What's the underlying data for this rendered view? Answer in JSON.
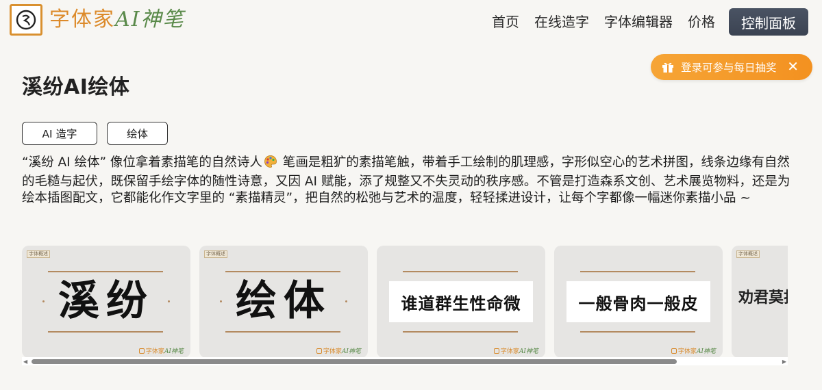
{
  "header": {
    "logo": {
      "brand_orange": "字体家",
      "brand_green": "AI神笔"
    },
    "nav": [
      "首页",
      "在线造字",
      "字体编辑器",
      "价格"
    ],
    "dashboard_label": "控制面板"
  },
  "promo": {
    "label": "登录可参与每日抽奖",
    "close_glyph": "✕"
  },
  "page": {
    "title": "溪纷AI绘体",
    "tags": [
      "AI 造字",
      "绘体"
    ],
    "description_before_emoji": "“溪纷 AI 绘体” 像位拿着素描笔的自然诗人",
    "description_after_emoji": " 笔画是粗犷的素描笔触，带着手工绘制的肌理感，字形似空心的艺术拼图，线条边缘有自然的毛糙与起伏，既保留手绘字体的随性诗意，又因 AI 赋能，添了规整又不失灵动的秩序感。不管是打造森系文创、艺术展览物料，还是为绘本插图配文，它都能化作文字里的 “素描精灵”，把自然的松弛与艺术的温度，轻轻揉进设计，让每个字都像一幅迷你素描小品 ~"
  },
  "gallery": {
    "card_tag": "字体概述",
    "card_brand_orange": "字体家",
    "card_brand_green": "AI神笔",
    "cards": [
      {
        "text": "溪纷"
      },
      {
        "text": "绘体"
      },
      {
        "text": "谁道群生性命微"
      },
      {
        "text": "一般骨肉一般皮"
      },
      {
        "text": "劝君莫打"
      }
    ]
  },
  "colors": {
    "accent_orange": "#f39120",
    "dashboard_bg": "#3f4757",
    "card_bg": "#e6e5e3",
    "rule_brown": "#b38a60"
  }
}
